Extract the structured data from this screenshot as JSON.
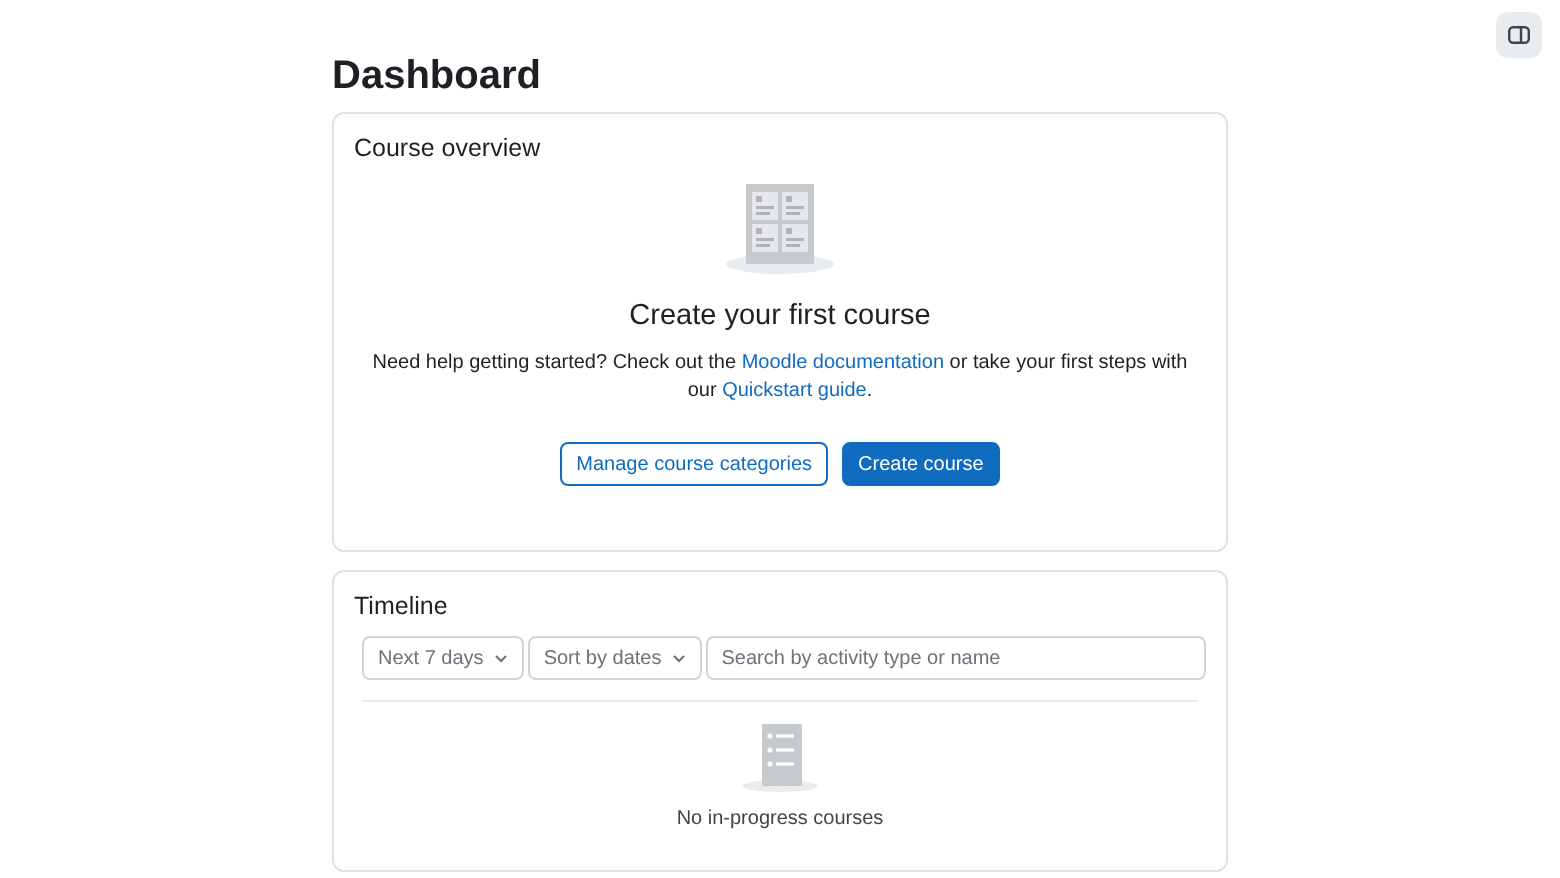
{
  "page_title": "Dashboard",
  "course_overview": {
    "title": "Course overview",
    "empty_heading": "Create your first course",
    "help_text": [
      {
        "kind": "text",
        "text": "Need help getting started? Check out the "
      },
      {
        "kind": "link",
        "text": "Moodle documentation"
      },
      {
        "kind": "text",
        "text": " or take your first steps with our "
      },
      {
        "kind": "link",
        "text": "Quickstart guide"
      },
      {
        "kind": "text",
        "text": "."
      }
    ],
    "buttons": [
      {
        "label": "Manage course categories",
        "kind": "secondary"
      },
      {
        "label": "Create course",
        "kind": "primary"
      }
    ]
  },
  "timeline": {
    "title": "Timeline",
    "filters": [
      {
        "label": "Next 7 days"
      },
      {
        "label": "Sort by dates"
      }
    ],
    "search": {
      "placeholder": "Search by activity type or name"
    },
    "empty_text": "No in-progress courses"
  }
}
